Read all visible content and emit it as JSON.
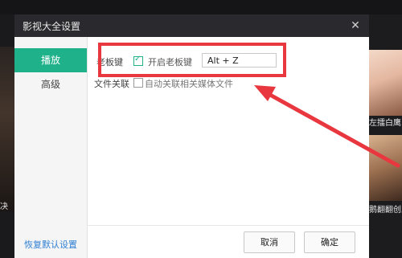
{
  "dialog": {
    "title": "影视大全设置"
  },
  "sidebar": {
    "items": [
      {
        "label": "播放",
        "active": true
      },
      {
        "label": "高级",
        "active": false
      }
    ],
    "restore_label": "恢复默认设置"
  },
  "settings": {
    "boss_key": {
      "label": "老板键",
      "checkbox_label": "开启老板键",
      "checked": true,
      "hotkey": "Alt + Z"
    },
    "file_assoc": {
      "label": "文件关联",
      "checkbox_label": "自动关联相关媒体文件",
      "checked": false
    }
  },
  "buttons": {
    "cancel": "取消",
    "ok": "确定"
  },
  "background": {
    "thumb_a_caption": "左擂白鹰",
    "thumb_b_caption": "鹅翻翻创业",
    "left_caption": "决"
  },
  "colors": {
    "accent": "#1fb18a",
    "highlight": "#e8373f",
    "link": "#2f7fd3"
  }
}
